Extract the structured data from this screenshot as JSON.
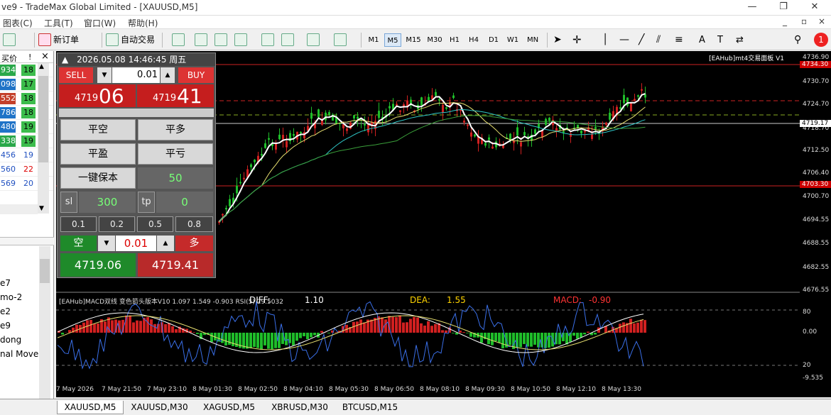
{
  "window": {
    "title": "ve9 - TradeMax Global Limited - [XAUUSD,M5]"
  },
  "menu": {
    "items": [
      "图表(C)",
      "工具(T)",
      "窗口(W)",
      "帮助(H)"
    ]
  },
  "toolbar": {
    "new_order": "新订单",
    "auto_trade": "自动交易",
    "timeframes": [
      "M1",
      "M5",
      "M15",
      "M30",
      "H1",
      "H4",
      "D1",
      "W1",
      "MN"
    ],
    "active_timeframe": "M5",
    "notification_count": "1"
  },
  "market_watch": {
    "headers": [
      "买价",
      "!"
    ],
    "rows": [
      {
        "bid": "934",
        "spread": "18",
        "color": "#2aa84a"
      },
      {
        "bid": "098",
        "spread": "17",
        "color": "#1f73c7"
      },
      {
        "bid": "552",
        "spread": "18",
        "color": "#c4402a"
      },
      {
        "bid": "786",
        "spread": "18",
        "color": "#1f73c7"
      },
      {
        "bid": "480",
        "spread": "19",
        "color": "#1f73c7"
      },
      {
        "bid": "338",
        "spread": "19",
        "color": "#2aa84a"
      },
      {
        "bid": "456",
        "spread": "19",
        "color": "#fff"
      },
      {
        "bid": "560",
        "spread": "22",
        "color": "#fff"
      },
      {
        "bid": "569",
        "spread": "20",
        "color": "#fff"
      }
    ]
  },
  "navigator": {
    "items": [
      "e7",
      "mo-2",
      "e2",
      "e9",
      "dong",
      "nal Move"
    ]
  },
  "chart": {
    "label": "[EAHub]mt4交易面板 V1",
    "price_ticks": [
      "4736.90",
      "4730.70",
      "4724.70",
      "4718.70",
      "4712.50",
      "4706.40",
      "4700.70",
      "4694.55",
      "4688.55",
      "4682.55",
      "4676.55"
    ],
    "price_tag_top": "4734.30",
    "price_tag_current": "4719.17",
    "price_tag_low": "4703.30",
    "time_ticks": [
      "7 May 2026",
      "7 May 21:50",
      "7 May 23:10",
      "8 May 01:30",
      "8 May 02:50",
      "8 May 04:10",
      "8 May 05:30",
      "8 May 06:50",
      "8 May 08:10",
      "8 May 09:30",
      "8 May 10:50",
      "8 May 12:10",
      "8 May 13:30"
    ],
    "sub_ticks": [
      "80",
      "0.00",
      "20",
      "-9.535"
    ],
    "sub_label": "[EAHub]MACD双线 变色箭头版本V10 1.097 1.549 -0.903  RSI(5) 29.5032",
    "diff_label": "DIFF:",
    "diff_value": "1.10",
    "dea_label": "DEA:",
    "dea_value": "1.55",
    "macd_label": "MACD:",
    "macd_value": "-0.90"
  },
  "panel": {
    "datetime": "2026.05.08 14:46:45 周五",
    "sell_label": "SELL",
    "buy_label": "BUY",
    "lot": "0.01",
    "sell_price_small": "4719",
    "sell_price_big": "06",
    "buy_price_small": "4719",
    "buy_price_big": "41",
    "close_short": "平空",
    "close_long": "平多",
    "close_profit": "平盈",
    "close_loss": "平亏",
    "breakeven": "一键保本",
    "breakeven_value": "50",
    "sl_label": "sl",
    "sl_value": "300",
    "tp_label": "tp",
    "tp_value": "0",
    "lots": [
      "0.1",
      "0.2",
      "0.5",
      "0.8"
    ],
    "short_label": "空",
    "long_label": "多",
    "lot2": "0.01",
    "bid_price": "4719.06",
    "ask_price": "4719.41"
  },
  "tabs": [
    "XAUUSD,M5",
    "XAUUSD,M30",
    "XAGUSD,M5",
    "XBRUSD,M30",
    "BTCUSD,M15"
  ],
  "active_tab": "XAUUSD,M5"
}
